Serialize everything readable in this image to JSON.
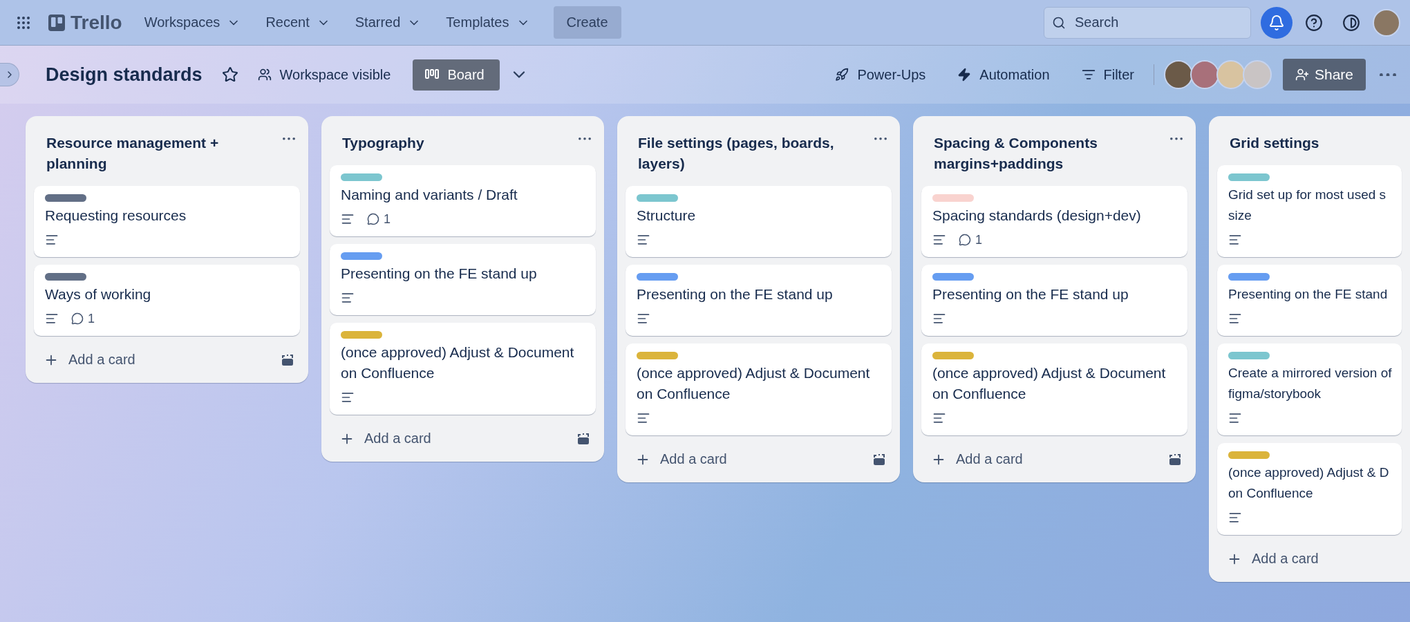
{
  "topbar": {
    "logo": "Trello",
    "menus": [
      {
        "label": "Workspaces"
      },
      {
        "label": "Recent"
      },
      {
        "label": "Starred"
      },
      {
        "label": "Templates"
      }
    ],
    "create": "Create",
    "search": {
      "placeholder": "Search"
    }
  },
  "board": {
    "title": "Design standards",
    "starred": false,
    "visibility": "Workspace visible",
    "view": "Board",
    "actions": [
      {
        "kind": "powerups",
        "label": "Power-Ups"
      },
      {
        "kind": "automation",
        "label": "Automation"
      },
      {
        "kind": "filter",
        "label": "Filter"
      }
    ],
    "share": "Share"
  },
  "lists": [
    {
      "title": "Resource management + planning",
      "add": "Add a card",
      "cards": [
        {
          "color": "#626f86",
          "title": "Requesting resources",
          "description": true
        },
        {
          "color": "#626f86",
          "title": "Ways of working",
          "description": true,
          "comments": "1"
        }
      ]
    },
    {
      "title": "Typography",
      "add": "Add a card",
      "cards": [
        {
          "color": "#7cc6cf",
          "title": "Naming and variants / Draft",
          "description": true,
          "comments": "1"
        },
        {
          "color": "#669df1",
          "title": "Presenting on the FE stand up",
          "description": true
        },
        {
          "color": "#dbb43b",
          "title": "(once approved) Adjust & Document on Confluence",
          "description": true
        }
      ]
    },
    {
      "title": "File settings (pages, boards, layers)",
      "add": "Add a card",
      "cards": [
        {
          "color": "#7cc6cf",
          "title": "Structure",
          "description": true
        },
        {
          "color": "#669df1",
          "title": "Presenting on the FE stand up",
          "description": true
        },
        {
          "color": "#dbb43b",
          "title": "(once approved) Adjust & Document on Confluence",
          "description": true
        }
      ]
    },
    {
      "title": "Spacing & Components margins+paddings",
      "add": "Add a card",
      "cards": [
        {
          "color": "#f9d3cf",
          "title": "Spacing standards (design+dev)",
          "description": true,
          "comments": "1"
        },
        {
          "color": "#669df1",
          "title": "Presenting on the FE stand up",
          "description": true
        },
        {
          "color": "#dbb43b",
          "title": "(once approved) Adjust & Document on Confluence",
          "description": true
        }
      ]
    },
    {
      "title": "Grid settings",
      "add": "Add a card",
      "cut": true,
      "cards": [
        {
          "color": "#7cc6cf",
          "title": "Grid set up for most used s\nsize",
          "description": true
        },
        {
          "color": "#669df1",
          "title": "Presenting on the FE stand",
          "description": true
        },
        {
          "color": "#7cc6cf",
          "title": "Create a mirrored version of\nfigma/storybook",
          "description": true
        },
        {
          "color": "#dbb43b",
          "title": "(once approved) Adjust & D\non Confluence",
          "description": true
        }
      ]
    }
  ]
}
